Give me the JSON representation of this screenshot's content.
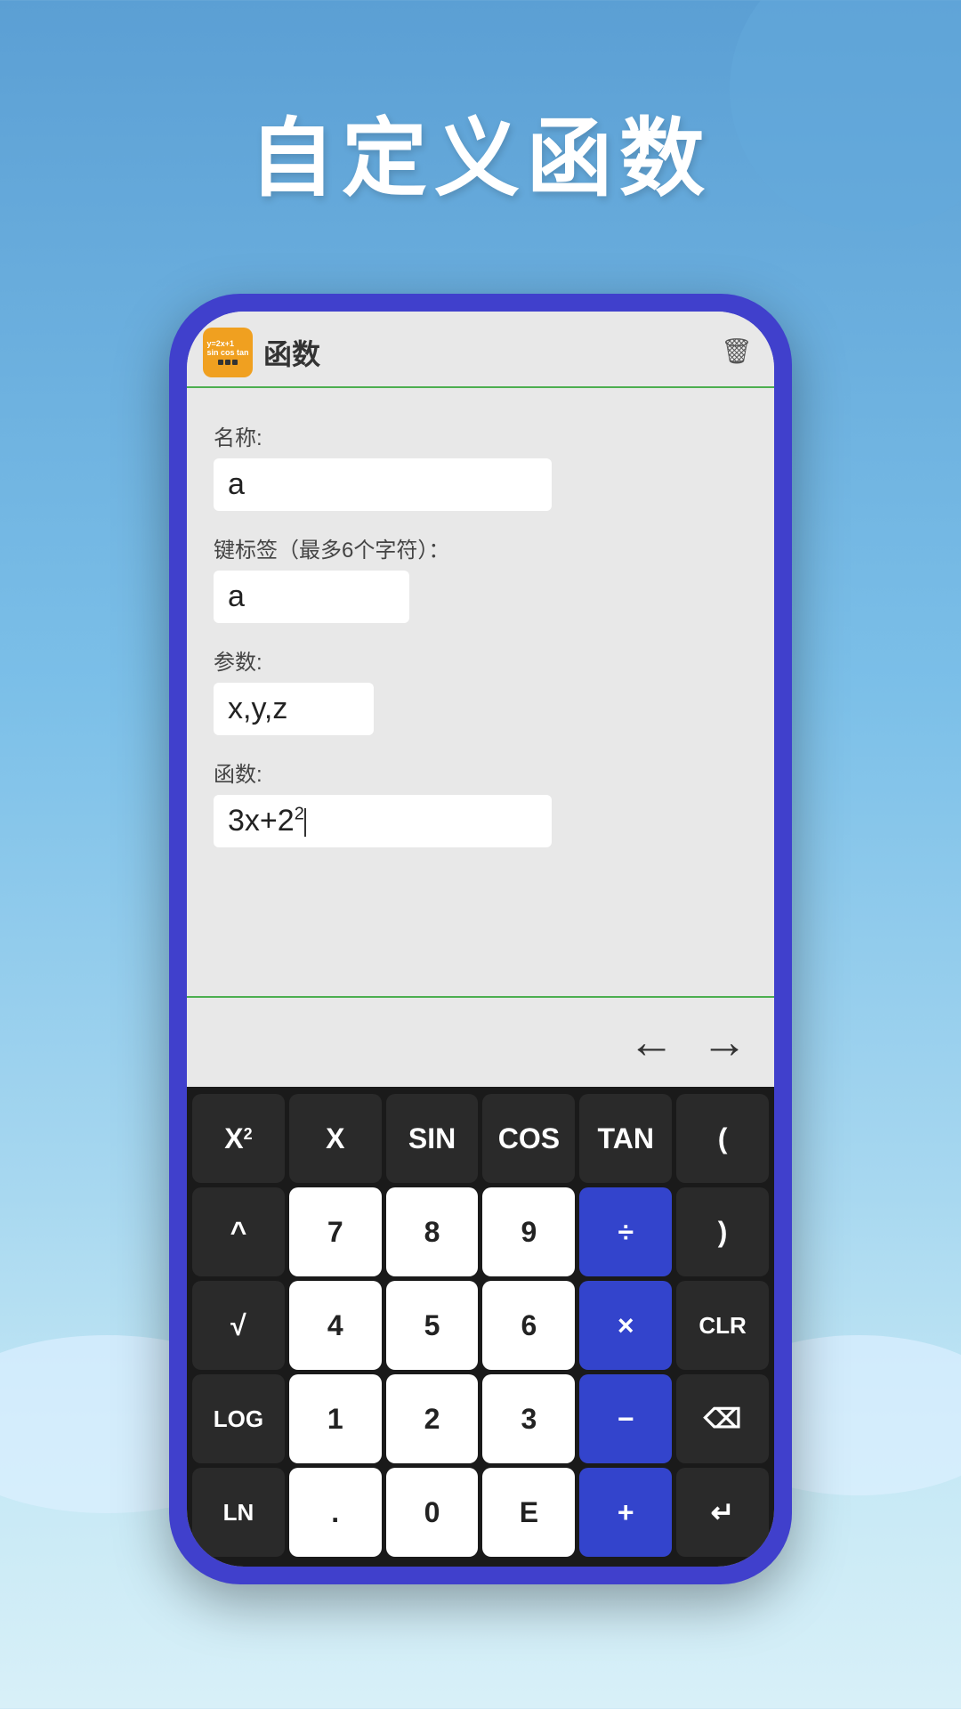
{
  "page": {
    "title": "自定义函数",
    "background_top_color": "#5b9fd4",
    "background_bottom_color": "#c5e8f5"
  },
  "app_header": {
    "app_name": "函数",
    "trash_label": "🗑"
  },
  "form": {
    "name_label": "名称:",
    "name_value": "a",
    "key_label": "键标签（最多6个字符）：",
    "key_value": "a",
    "params_label": "参数:",
    "params_value": "x,y,z",
    "function_label": "函数:",
    "function_value": "3x+2"
  },
  "keyboard": {
    "rows": [
      [
        {
          "label": "X²",
          "type": "dark",
          "sup": true
        },
        {
          "label": "X",
          "type": "dark"
        },
        {
          "label": "SIN",
          "type": "dark"
        },
        {
          "label": "COS",
          "type": "dark"
        },
        {
          "label": "TAN",
          "type": "dark"
        },
        {
          "label": "(",
          "type": "dark"
        }
      ],
      [
        {
          "label": "^",
          "type": "dark"
        },
        {
          "label": "7",
          "type": "light"
        },
        {
          "label": "8",
          "type": "light"
        },
        {
          "label": "9",
          "type": "light"
        },
        {
          "label": "÷",
          "type": "blue"
        },
        {
          "label": ")",
          "type": "dark"
        }
      ],
      [
        {
          "label": "√",
          "type": "dark"
        },
        {
          "label": "4",
          "type": "light"
        },
        {
          "label": "5",
          "type": "light"
        },
        {
          "label": "6",
          "type": "light"
        },
        {
          "label": "×",
          "type": "blue"
        },
        {
          "label": "CLR",
          "type": "dark"
        }
      ],
      [
        {
          "label": "LOG",
          "type": "dark"
        },
        {
          "label": "1",
          "type": "light"
        },
        {
          "label": "2",
          "type": "light"
        },
        {
          "label": "3",
          "type": "light"
        },
        {
          "label": "−",
          "type": "blue"
        },
        {
          "label": "⌫",
          "type": "dark"
        }
      ],
      [
        {
          "label": "LN",
          "type": "dark"
        },
        {
          "label": ".",
          "type": "light"
        },
        {
          "label": "0",
          "type": "light"
        },
        {
          "label": "E",
          "type": "light"
        },
        {
          "label": "+",
          "type": "blue"
        },
        {
          "label": "↵",
          "type": "dark"
        }
      ]
    ]
  },
  "nav": {
    "back_arrow": "←",
    "forward_arrow": "→"
  }
}
